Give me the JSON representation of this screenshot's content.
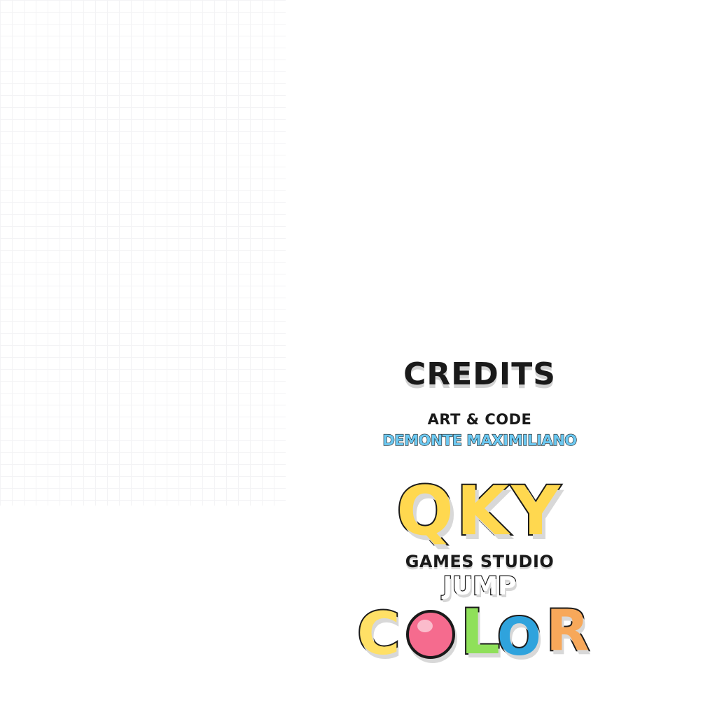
{
  "credits": {
    "title": "CREDITS",
    "role": "ART & CODE",
    "author": "DEMONTE MAXIMILIANO",
    "studio_name": "QKY",
    "studio_subtitle": "GAMES STUDIO",
    "game_title_top": "JUMP",
    "game_title_letters": [
      "C",
      "L",
      "O",
      "R"
    ]
  },
  "colors": {
    "studio_logo": "#ffd84f",
    "author_name": "#6cc9f2",
    "letter_c": "#ffe066",
    "ball": "#f56b8e",
    "letter_l": "#8fe05a",
    "letter_o": "#2fa3dd",
    "letter_r": "#f7a85a"
  },
  "icons": {
    "ball": "pink-ball-icon"
  }
}
